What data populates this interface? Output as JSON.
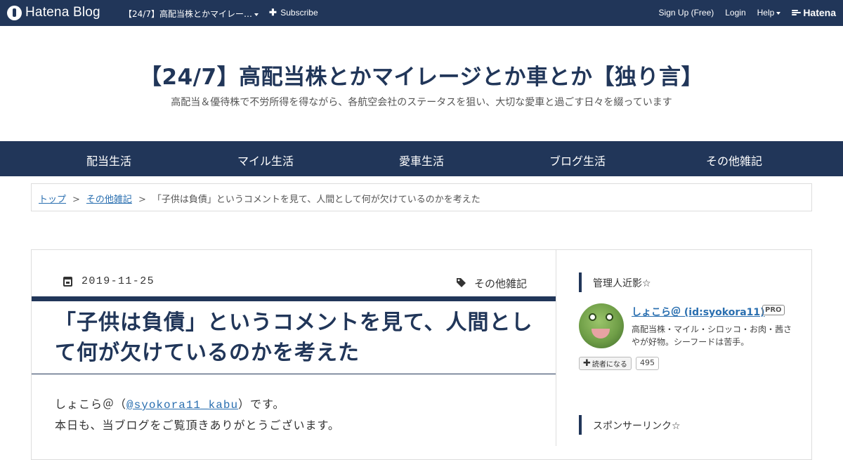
{
  "topbar": {
    "brand": "Hatena Blog",
    "blog_selector": "【24/7】高配当株とかマイレー…",
    "subscribe": "Subscribe",
    "signup": "Sign Up (Free)",
    "login": "Login",
    "help": "Help",
    "hatena": "Hatena"
  },
  "header": {
    "title": "【24/7】高配当株とかマイレージとか車とか【独り言】",
    "description": "高配当＆優待株で不労所得を得ながら、各航空会社のステータスを狙い、大切な愛車と過ごす日々を綴っています"
  },
  "nav": {
    "items": [
      "配当生活",
      "マイル生活",
      "愛車生活",
      "ブログ生活",
      "その他雑記"
    ]
  },
  "breadcrumb": {
    "home": "トップ",
    "category": "その他雑記",
    "sep": ">",
    "current": "「子供は負債」というコメントを見て、人間として何が欠けているのかを考えた"
  },
  "entry": {
    "date": "2019-11-25",
    "category": "その他雑記",
    "title": "「子供は負債」というコメントを見て、人間として何が欠けているのかを考えた",
    "p1_before": "しょこら＠（",
    "p1_link": "@syokora11_kabu",
    "p1_after": "）です。",
    "p2": "本日も、当ブログをご覧頂きありがとうございます。"
  },
  "sidebar": {
    "profile_heading": "管理人近影☆",
    "profile_name": "しょこら＠ (id:syokora11)",
    "pro_badge": "PRO",
    "profile_desc": "高配当株・マイル・シロッコ・お肉・茜さやが好物。シーフードは苦手。",
    "reader_button": "読者になる",
    "reader_count": "495",
    "sponsor_heading": "スポンサーリンク☆"
  },
  "colors": {
    "navy": "#213659",
    "link": "#2a6fb0"
  }
}
